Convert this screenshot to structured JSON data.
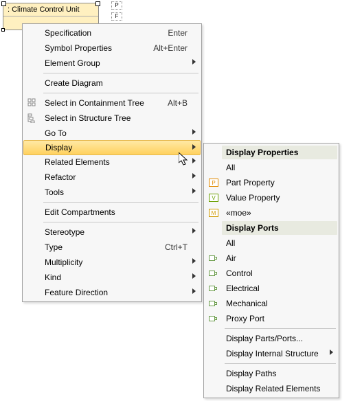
{
  "diagram": {
    "label": ": Climate Control Unit"
  },
  "main_menu": {
    "specification": {
      "label": "Specification",
      "accel": "Enter"
    },
    "symbol_properties": {
      "label": "Symbol Properties",
      "accel": "Alt+Enter"
    },
    "element_group": {
      "label": "Element Group"
    },
    "create_diagram": {
      "label": "Create Diagram"
    },
    "sel_containment": {
      "label": "Select in Containment Tree",
      "accel": "Alt+B"
    },
    "sel_structure": {
      "label": "Select in Structure Tree"
    },
    "go_to": {
      "label": "Go To"
    },
    "display": {
      "label": "Display"
    },
    "related_elements": {
      "label": "Related Elements"
    },
    "refactor": {
      "label": "Refactor"
    },
    "tools": {
      "label": "Tools"
    },
    "edit_compartments": {
      "label": "Edit Compartments"
    },
    "stereotype": {
      "label": "Stereotype"
    },
    "type": {
      "label": "Type",
      "accel": "Ctrl+T"
    },
    "multiplicity": {
      "label": "Multiplicity"
    },
    "kind": {
      "label": "Kind"
    },
    "feature_direction": {
      "label": "Feature Direction"
    }
  },
  "sub_menu": {
    "hdr_props": {
      "label": "Display Properties"
    },
    "all_props": {
      "label": "All"
    },
    "part_prop": {
      "label": "Part Property",
      "icon": "P",
      "icon_color": "#e28a00"
    },
    "value_prop": {
      "label": "Value Property",
      "icon": "V",
      "icon_color": "#6aa000"
    },
    "moe": {
      "label": "«moe»",
      "icon": "M",
      "icon_color": "#d09a00"
    },
    "hdr_ports": {
      "label": "Display Ports"
    },
    "all_ports": {
      "label": "All"
    },
    "air": {
      "label": "Air"
    },
    "control": {
      "label": "Control"
    },
    "electrical": {
      "label": "Electrical"
    },
    "mechanical": {
      "label": "Mechanical"
    },
    "proxy_port": {
      "label": "Proxy Port"
    },
    "display_pp": {
      "label": "Display Parts/Ports..."
    },
    "display_int": {
      "label": "Display Internal Structure"
    },
    "display_paths": {
      "label": "Display Paths"
    },
    "display_related": {
      "label": "Display Related Elements"
    }
  }
}
